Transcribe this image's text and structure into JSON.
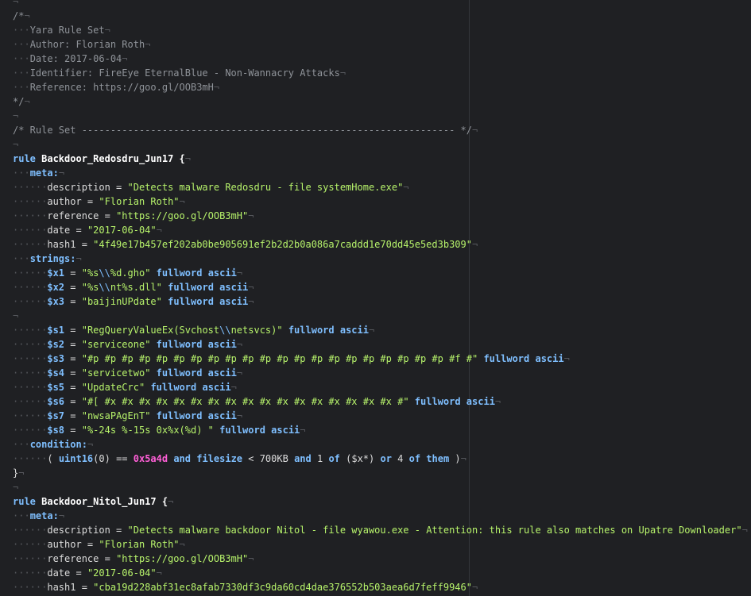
{
  "theme": {
    "background": "#1f2023",
    "comment": "#8f9399",
    "keyword": "#7fbfff",
    "string": "#b7f36b",
    "number": "#ff5fd7",
    "invisible": "#55575c"
  },
  "code_lines": [
    {
      "segments": [
        {
          "t": "¬",
          "c": "eol"
        }
      ]
    },
    {
      "segments": [
        {
          "t": "/*",
          "c": "comment"
        },
        {
          "t": "¬",
          "c": "eol"
        }
      ]
    },
    {
      "segments": [
        {
          "t": "···",
          "c": "ws"
        },
        {
          "t": "Yara Rule Set",
          "c": "comment"
        },
        {
          "t": "¬",
          "c": "eol"
        }
      ]
    },
    {
      "segments": [
        {
          "t": "···",
          "c": "ws"
        },
        {
          "t": "Author: Florian Roth",
          "c": "comment"
        },
        {
          "t": "¬",
          "c": "eol"
        }
      ]
    },
    {
      "segments": [
        {
          "t": "···",
          "c": "ws"
        },
        {
          "t": "Date: 2017-06-04",
          "c": "comment"
        },
        {
          "t": "¬",
          "c": "eol"
        }
      ]
    },
    {
      "segments": [
        {
          "t": "···",
          "c": "ws"
        },
        {
          "t": "Identifier: FireEye EternalBlue - Non-Wannacry Attacks",
          "c": "comment"
        },
        {
          "t": "¬",
          "c": "eol"
        }
      ]
    },
    {
      "segments": [
        {
          "t": "···",
          "c": "ws"
        },
        {
          "t": "Reference: https://goo.gl/OOB3mH",
          "c": "comment"
        },
        {
          "t": "¬",
          "c": "eol"
        }
      ]
    },
    {
      "segments": [
        {
          "t": "*/",
          "c": "comment"
        },
        {
          "t": "¬",
          "c": "eol"
        }
      ]
    },
    {
      "segments": [
        {
          "t": "¬",
          "c": "eol"
        }
      ]
    },
    {
      "segments": [
        {
          "t": "/* Rule Set ----------------------------------------------------------------- */",
          "c": "comment"
        },
        {
          "t": "¬",
          "c": "eol"
        }
      ]
    },
    {
      "segments": [
        {
          "t": "¬",
          "c": "eol"
        }
      ]
    },
    {
      "segments": [
        {
          "t": "rule",
          "c": "kw"
        },
        {
          "t": " Backdoor_Redosdru_Jun17 {",
          "c": "rule"
        },
        {
          "t": "¬",
          "c": "eol"
        }
      ]
    },
    {
      "segments": [
        {
          "t": "···",
          "c": "ws"
        },
        {
          "t": "meta:",
          "c": "section"
        },
        {
          "t": "¬",
          "c": "eol"
        }
      ]
    },
    {
      "segments": [
        {
          "t": "······",
          "c": "ws"
        },
        {
          "t": "description = ",
          "c": "plain"
        },
        {
          "t": "\"Detects malware Redosdru - file systemHome.exe\"",
          "c": "str"
        },
        {
          "t": "¬",
          "c": "eol"
        }
      ]
    },
    {
      "segments": [
        {
          "t": "······",
          "c": "ws"
        },
        {
          "t": "author = ",
          "c": "plain"
        },
        {
          "t": "\"Florian Roth\"",
          "c": "str"
        },
        {
          "t": "¬",
          "c": "eol"
        }
      ]
    },
    {
      "segments": [
        {
          "t": "······",
          "c": "ws"
        },
        {
          "t": "reference = ",
          "c": "plain"
        },
        {
          "t": "\"https://goo.gl/OOB3mH\"",
          "c": "str"
        },
        {
          "t": "¬",
          "c": "eol"
        }
      ]
    },
    {
      "segments": [
        {
          "t": "······",
          "c": "ws"
        },
        {
          "t": "date = ",
          "c": "plain"
        },
        {
          "t": "\"2017-06-04\"",
          "c": "str"
        },
        {
          "t": "¬",
          "c": "eol"
        }
      ]
    },
    {
      "segments": [
        {
          "t": "······",
          "c": "ws"
        },
        {
          "t": "hash1 = ",
          "c": "plain"
        },
        {
          "t": "\"4f49e17b457ef202ab0be905691ef2b2d2b0a086a7caddd1e70dd45e5ed3b309\"",
          "c": "str"
        },
        {
          "t": "¬",
          "c": "eol"
        }
      ]
    },
    {
      "segments": [
        {
          "t": "···",
          "c": "ws"
        },
        {
          "t": "strings:",
          "c": "section"
        },
        {
          "t": "¬",
          "c": "eol"
        }
      ]
    },
    {
      "segments": [
        {
          "t": "······",
          "c": "ws"
        },
        {
          "t": "$x1",
          "c": "var"
        },
        {
          "t": " = ",
          "c": "plain"
        },
        {
          "t": "\"%s",
          "c": "str"
        },
        {
          "t": "\\\\",
          "c": "esc"
        },
        {
          "t": "%d.gho\"",
          "c": "str"
        },
        {
          "t": " fullword ascii",
          "c": "kw"
        },
        {
          "t": "¬",
          "c": "eol"
        }
      ]
    },
    {
      "segments": [
        {
          "t": "······",
          "c": "ws"
        },
        {
          "t": "$x2",
          "c": "var"
        },
        {
          "t": " = ",
          "c": "plain"
        },
        {
          "t": "\"%s",
          "c": "str"
        },
        {
          "t": "\\\\",
          "c": "esc"
        },
        {
          "t": "nt%s.dll\"",
          "c": "str"
        },
        {
          "t": " fullword ascii",
          "c": "kw"
        },
        {
          "t": "¬",
          "c": "eol"
        }
      ]
    },
    {
      "segments": [
        {
          "t": "······",
          "c": "ws"
        },
        {
          "t": "$x3",
          "c": "var"
        },
        {
          "t": " = ",
          "c": "plain"
        },
        {
          "t": "\"baijinUPdate\"",
          "c": "str"
        },
        {
          "t": " fullword ascii",
          "c": "kw"
        },
        {
          "t": "¬",
          "c": "eol"
        }
      ]
    },
    {
      "segments": [
        {
          "t": "¬",
          "c": "eol"
        }
      ]
    },
    {
      "segments": [
        {
          "t": "······",
          "c": "ws"
        },
        {
          "t": "$s1",
          "c": "var"
        },
        {
          "t": " = ",
          "c": "plain"
        },
        {
          "t": "\"RegQueryValueEx(Svchost",
          "c": "str"
        },
        {
          "t": "\\\\",
          "c": "esc"
        },
        {
          "t": "netsvcs)\"",
          "c": "str"
        },
        {
          "t": " fullword ascii",
          "c": "kw"
        },
        {
          "t": "¬",
          "c": "eol"
        }
      ]
    },
    {
      "segments": [
        {
          "t": "······",
          "c": "ws"
        },
        {
          "t": "$s2",
          "c": "var"
        },
        {
          "t": " = ",
          "c": "plain"
        },
        {
          "t": "\"serviceone\"",
          "c": "str"
        },
        {
          "t": " fullword ascii",
          "c": "kw"
        },
        {
          "t": "¬",
          "c": "eol"
        }
      ]
    },
    {
      "segments": [
        {
          "t": "······",
          "c": "ws"
        },
        {
          "t": "$s3",
          "c": "var"
        },
        {
          "t": " = ",
          "c": "plain"
        },
        {
          "t": "\"#p #p #p #p #p #p #p #p #p #p #p #p #p #p #p #p #p #p #p #p #p #f #\"",
          "c": "str"
        },
        {
          "t": " fullword ascii",
          "c": "kw"
        },
        {
          "t": "¬",
          "c": "eol"
        }
      ]
    },
    {
      "segments": [
        {
          "t": "······",
          "c": "ws"
        },
        {
          "t": "$s4",
          "c": "var"
        },
        {
          "t": " = ",
          "c": "plain"
        },
        {
          "t": "\"servicetwo\"",
          "c": "str"
        },
        {
          "t": " fullword ascii",
          "c": "kw"
        },
        {
          "t": "¬",
          "c": "eol"
        }
      ]
    },
    {
      "segments": [
        {
          "t": "······",
          "c": "ws"
        },
        {
          "t": "$s5",
          "c": "var"
        },
        {
          "t": " = ",
          "c": "plain"
        },
        {
          "t": "\"UpdateCrc\"",
          "c": "str"
        },
        {
          "t": " fullword ascii",
          "c": "kw"
        },
        {
          "t": "¬",
          "c": "eol"
        }
      ]
    },
    {
      "segments": [
        {
          "t": "······",
          "c": "ws"
        },
        {
          "t": "$s6",
          "c": "var"
        },
        {
          "t": " = ",
          "c": "plain"
        },
        {
          "t": "\"#[ #x #x #x #x #x #x #x #x #x #x #x #x #x #x #x #x #x #\"",
          "c": "str"
        },
        {
          "t": " fullword ascii",
          "c": "kw"
        },
        {
          "t": "¬",
          "c": "eol"
        }
      ]
    },
    {
      "segments": [
        {
          "t": "······",
          "c": "ws"
        },
        {
          "t": "$s7",
          "c": "var"
        },
        {
          "t": " = ",
          "c": "plain"
        },
        {
          "t": "\"nwsaPAgEnT\"",
          "c": "str"
        },
        {
          "t": " fullword ascii",
          "c": "kw"
        },
        {
          "t": "¬",
          "c": "eol"
        }
      ]
    },
    {
      "segments": [
        {
          "t": "······",
          "c": "ws"
        },
        {
          "t": "$s8",
          "c": "var"
        },
        {
          "t": " = ",
          "c": "plain"
        },
        {
          "t": "\"%-24s %-15s 0x%x(%d) \"",
          "c": "str"
        },
        {
          "t": " fullword ascii",
          "c": "kw"
        },
        {
          "t": "¬",
          "c": "eol"
        }
      ]
    },
    {
      "segments": [
        {
          "t": "···",
          "c": "ws"
        },
        {
          "t": "condition:",
          "c": "section"
        },
        {
          "t": "¬",
          "c": "eol"
        }
      ]
    },
    {
      "segments": [
        {
          "t": "······",
          "c": "ws"
        },
        {
          "t": "( ",
          "c": "plain"
        },
        {
          "t": "uint16",
          "c": "kw"
        },
        {
          "t": "(0) == ",
          "c": "plain"
        },
        {
          "t": "0x5a4d",
          "c": "num"
        },
        {
          "t": " and filesize",
          "c": "kw"
        },
        {
          "t": " < 700KB ",
          "c": "plain"
        },
        {
          "t": "and",
          "c": "kw"
        },
        {
          "t": " 1 ",
          "c": "plain"
        },
        {
          "t": "of",
          "c": "kw"
        },
        {
          "t": " ($x*) ",
          "c": "plain"
        },
        {
          "t": "or",
          "c": "kw"
        },
        {
          "t": " 4 ",
          "c": "plain"
        },
        {
          "t": "of them",
          "c": "kw"
        },
        {
          "t": " )",
          "c": "plain"
        },
        {
          "t": "¬",
          "c": "eol"
        }
      ]
    },
    {
      "segments": [
        {
          "t": "}",
          "c": "plain"
        },
        {
          "t": "¬",
          "c": "eol"
        }
      ]
    },
    {
      "segments": [
        {
          "t": "¬",
          "c": "eol"
        }
      ]
    },
    {
      "segments": [
        {
          "t": "rule",
          "c": "kw"
        },
        {
          "t": " Backdoor_Nitol_Jun17 {",
          "c": "rule"
        },
        {
          "t": "¬",
          "c": "eol"
        }
      ]
    },
    {
      "segments": [
        {
          "t": "···",
          "c": "ws"
        },
        {
          "t": "meta:",
          "c": "section"
        },
        {
          "t": "¬",
          "c": "eol"
        }
      ]
    },
    {
      "segments": [
        {
          "t": "······",
          "c": "ws"
        },
        {
          "t": "description = ",
          "c": "plain"
        },
        {
          "t": "\"Detects malware backdoor Nitol - file wyawou.exe - Attention: this rule also matches on Upatre Downloader\"",
          "c": "str"
        },
        {
          "t": "¬",
          "c": "eol"
        }
      ]
    },
    {
      "segments": [
        {
          "t": "······",
          "c": "ws"
        },
        {
          "t": "author = ",
          "c": "plain"
        },
        {
          "t": "\"Florian Roth\"",
          "c": "str"
        },
        {
          "t": "¬",
          "c": "eol"
        }
      ]
    },
    {
      "segments": [
        {
          "t": "······",
          "c": "ws"
        },
        {
          "t": "reference = ",
          "c": "plain"
        },
        {
          "t": "\"https://goo.gl/OOB3mH\"",
          "c": "str"
        },
        {
          "t": "¬",
          "c": "eol"
        }
      ]
    },
    {
      "segments": [
        {
          "t": "······",
          "c": "ws"
        },
        {
          "t": "date = ",
          "c": "plain"
        },
        {
          "t": "\"2017-06-04\"",
          "c": "str"
        },
        {
          "t": "¬",
          "c": "eol"
        }
      ]
    },
    {
      "segments": [
        {
          "t": "······",
          "c": "ws"
        },
        {
          "t": "hash1 = ",
          "c": "plain"
        },
        {
          "t": "\"cba19d228abf31ec8afab7330df3c9da60cd4dae376552b503aea6d7feff9946\"",
          "c": "str"
        },
        {
          "t": "¬",
          "c": "eol"
        }
      ]
    }
  ]
}
